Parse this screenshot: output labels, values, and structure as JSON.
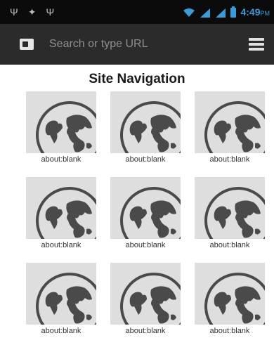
{
  "status_bar": {
    "time": "4:49",
    "ampm": "PM",
    "accent_color": "#3a9bd8"
  },
  "toolbar": {
    "placeholder": "Search or type URL",
    "tab_icon": "tab-overview-icon",
    "menu_icon": "menu-icon"
  },
  "main": {
    "title": "Site Navigation",
    "tiles": [
      {
        "label": "about:blank",
        "icon": "globe-icon"
      },
      {
        "label": "about:blank",
        "icon": "globe-icon"
      },
      {
        "label": "about:blank",
        "icon": "globe-icon"
      },
      {
        "label": "about:blank",
        "icon": "globe-icon"
      },
      {
        "label": "about:blank",
        "icon": "globe-icon"
      },
      {
        "label": "about:blank",
        "icon": "globe-icon"
      },
      {
        "label": "about:blank",
        "icon": "globe-icon"
      },
      {
        "label": "about:blank",
        "icon": "globe-icon"
      },
      {
        "label": "about:blank",
        "icon": "globe-icon"
      }
    ]
  }
}
